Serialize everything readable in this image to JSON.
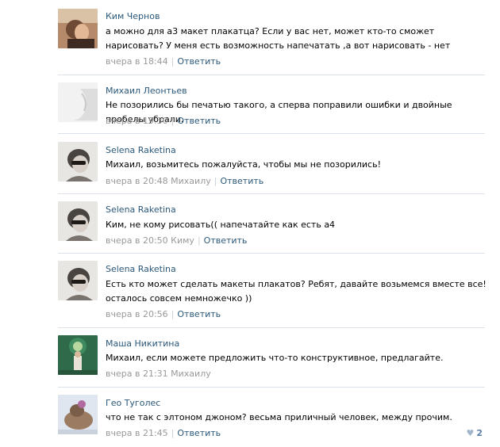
{
  "comments": [
    {
      "author": "Ким Чернов",
      "text": "а можно для а3 макет плакатца? Если у вас нет, может кто-то сможет нарисовать? У меня есть возможность напечатать ,а вот нарисовать - нет",
      "time": "вчера в 18:44",
      "recipient": "",
      "reply_label": "Ответить"
    },
    {
      "author": "Михаил Леонтьев",
      "text": "Не позорились бы печатью такого, а сперва поправили ошибки и двойные пробелы убрали.",
      "time": "вчера в 19:30",
      "recipient": "",
      "reply_label": "Ответить"
    },
    {
      "author": "Selena Raketina",
      "text": "Михаил, возьмитесь пожалуйста, чтобы мы не позорились!",
      "time": "вчера в 20:48",
      "recipient": "Михаилу",
      "reply_label": "Ответить"
    },
    {
      "author": "Selena Raketina",
      "text": "Ким, не кому рисовать(( напечатайте как есть а4",
      "time": "вчера в 20:50",
      "recipient": "Киму",
      "reply_label": "Ответить"
    },
    {
      "author": "Selena Raketina",
      "text": "Есть кто может сделать макеты плакатов? Ребят, давайте возьмемся вместе все! осталось совсем немножечко ))",
      "time": "вчера в 20:56",
      "recipient": "",
      "reply_label": "Ответить"
    },
    {
      "author": "Маша Никитина",
      "text": "Михаил, если можете предложить что-то конструктивное, предлагайте.",
      "time": "вчера в 21:31",
      "recipient": "Михаилу",
      "reply_label": ""
    },
    {
      "author": "Гео Туголес",
      "text": "что не так с элтоном джоном? весьма приличный человек, между прочим.",
      "time": "вчера в 21:45",
      "recipient": "",
      "reply_label": "Ответить"
    }
  ],
  "last_comment_likes": "2",
  "icons": {
    "like": "heart-icon"
  },
  "colors": {
    "link": "#2b587a",
    "meta": "#999999",
    "divider": "#dae1e8"
  }
}
